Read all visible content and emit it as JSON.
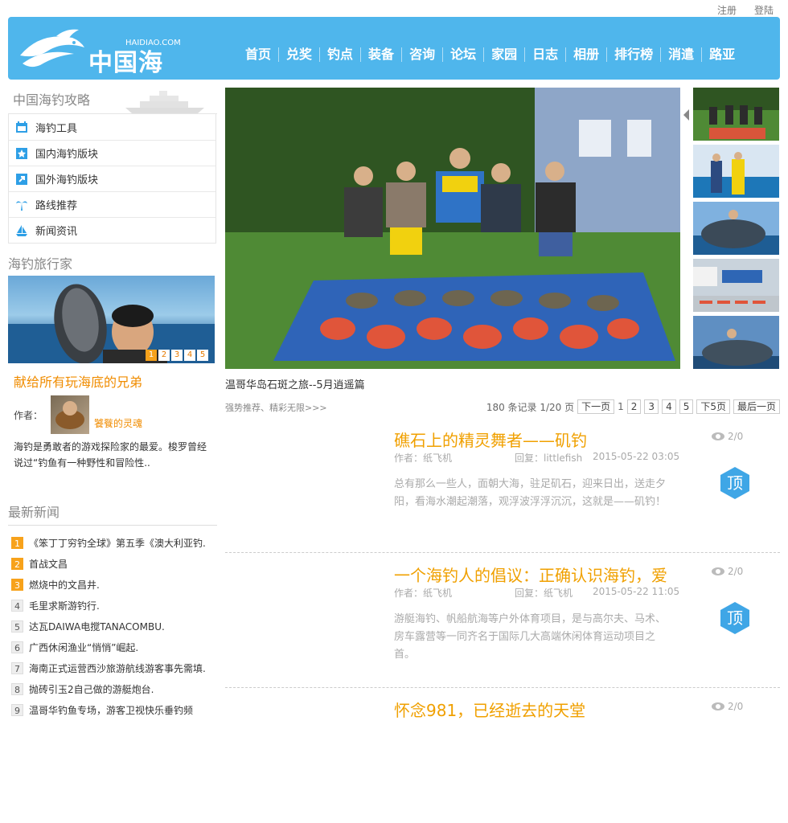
{
  "top_links": {
    "register": "注册",
    "login": "登陆"
  },
  "logo": {
    "text": "中国海钓",
    "domain": "HAIDIAO.COM"
  },
  "nav": [
    "首页",
    "兑奖",
    "钓点",
    "装备",
    "咨询",
    "论坛",
    "家园",
    "日志",
    "相册",
    "排行榜",
    "消遣",
    "路亚"
  ],
  "guide": {
    "title": "中国海钓攻略",
    "items": [
      "海钓工具",
      "国内海钓版块",
      "国外海钓版块",
      "路线推荐",
      "新闻资讯"
    ]
  },
  "travel": {
    "title": "海钓旅行家",
    "pager": [
      "1",
      "2",
      "3",
      "4",
      "5"
    ],
    "headline": "献给所有玩海底的兄弟",
    "author_label": "作者：",
    "author_name": "饕餮的灵魂",
    "desc": "海钓是勇敢者的游戏探险家的最爱。梭罗曾经说过“钓鱼有一种野性和冒险性.."
  },
  "news": {
    "title": "最新新闻",
    "items": [
      {
        "n": "1",
        "text": "《笨丁丁穷钓全球》第五季《澳大利亚钓."
      },
      {
        "n": "2",
        "text": "首战文昌"
      },
      {
        "n": "3",
        "text": "燃烧中的文昌井."
      },
      {
        "n": "4",
        "text": "毛里求斯游钓行."
      },
      {
        "n": "5",
        "text": "达瓦DAIWA电搅TANACOMBU."
      },
      {
        "n": "6",
        "text": "广西休闲渔业“悄悄”崛起."
      },
      {
        "n": "7",
        "text": "海南正式运营西沙旅游航线游客事先需填."
      },
      {
        "n": "8",
        "text": "抛砖引玉2自己做的游艇炮台."
      },
      {
        "n": "9",
        "text": "温哥华钓鱼专场，游客卫视快乐垂钓频"
      }
    ]
  },
  "banner": {
    "caption": "温哥华岛石斑之旅--5月逍遥篇"
  },
  "recommend": {
    "label": "强势推荐、精彩无限>>>",
    "summary": "180 条记录 1/20 页",
    "next": "下一页",
    "current": "1",
    "pages": [
      "2",
      "3",
      "4",
      "5"
    ],
    "next5": "下5页",
    "last": "最后一页"
  },
  "posts": [
    {
      "title": "礁石上的精灵舞者——矶钓",
      "author": "作者：纸飞机",
      "reply": "回复：littlefish",
      "date": "2015-05-22 03:05",
      "body": "总有那么一些人，面朝大海，驻足矶石，迎来日出，送走夕阳，看海水潮起潮落，观浮波浮浮沉沉，这就是——矶钓！",
      "views": "2/0",
      "badge": "顶"
    },
    {
      "title": "一个海钓人的倡议：正确认识海钓，爱",
      "author": "作者：纸飞机",
      "reply": "回复：纸飞机",
      "date": "2015-05-22 11:05",
      "body": "游艇海钓、帆船航海等户外体育项目，是与高尔夫、马术、房车露营等一同齐名于国际几大高端休闲体育运动项目之首。",
      "views": "2/0",
      "badge": "顶"
    },
    {
      "title": "怀念981，已经逝去的天堂",
      "views": "2/0"
    }
  ],
  "colors": {
    "header": "#4fb6ec",
    "accent": "#f0a000",
    "badge": "#3fa6e6"
  }
}
